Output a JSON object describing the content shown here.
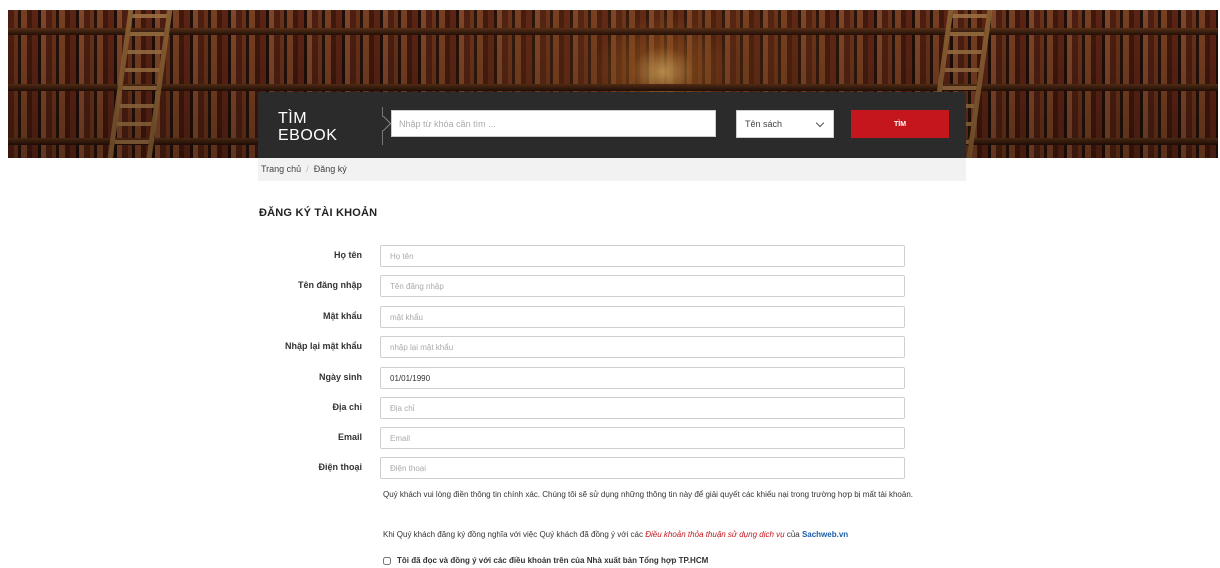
{
  "search": {
    "title_line1": "TÌM",
    "title_line2": "EBOOK",
    "placeholder": "Nhập từ khóa cần tìm ...",
    "select_value": "Tên sách",
    "button_label": "TÌM"
  },
  "breadcrumb": {
    "home": "Trang chủ",
    "separator": "/",
    "current": "Đăng ký"
  },
  "form": {
    "heading": "ĐĂNG KÝ TÀI KHOẢN",
    "fields": [
      {
        "label": "Họ tên",
        "placeholder": "Họ tên",
        "value": ""
      },
      {
        "label": "Tên đăng nhập",
        "placeholder": "Tên đăng nhập",
        "value": ""
      },
      {
        "label": "Mật khẩu",
        "placeholder": "mật khẩu",
        "value": ""
      },
      {
        "label": "Nhập lại mật khẩu",
        "placeholder": "nhập lại mật khẩu",
        "value": ""
      },
      {
        "label": "Ngày sinh",
        "placeholder": "",
        "value": "01/01/1990"
      },
      {
        "label": "Địa chỉ",
        "placeholder": "Địa chỉ",
        "value": ""
      },
      {
        "label": "Email",
        "placeholder": "Email",
        "value": ""
      },
      {
        "label": "Điện thoại",
        "placeholder": "Điện thoại",
        "value": ""
      }
    ],
    "note1": "Quý khách vui lòng điền thông tin chính xác. Chúng tôi sẽ sử dụng những thông tin này để giải quyết các khiếu nại trong trường hợp bị mất tài khoản.",
    "note2_prefix": "Khi Quý khách đăng ký đồng nghĩa với việc Quý khách đã đồng ý với các ",
    "note2_terms": "Điều khoản thỏa thuận sử dụng dịch vụ",
    "note2_middle": " của ",
    "note2_site": "Sachweb.vn",
    "agree_label": "Tôi đã đọc và đồng ý với các điều khoản trên của Nhà xuất bản Tổng hợp TP.HCM"
  },
  "colors": {
    "accent": "#c4161c",
    "search_box_bg": "#2b2b2b",
    "link_blue": "#1a5fa8"
  }
}
